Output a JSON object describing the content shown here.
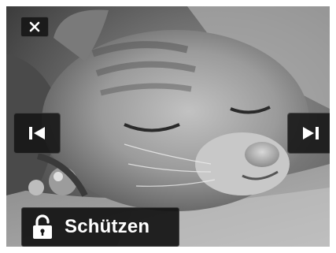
{
  "protect_bar": {
    "label": "Schützen",
    "icon": "lock-open-icon"
  },
  "controls": {
    "close_icon": "close-icon",
    "prev_icon": "skip-previous-icon",
    "next_icon": "skip-next-icon"
  },
  "colors": {
    "button_bg": "#141414",
    "icon_fg": "#ffffff"
  }
}
